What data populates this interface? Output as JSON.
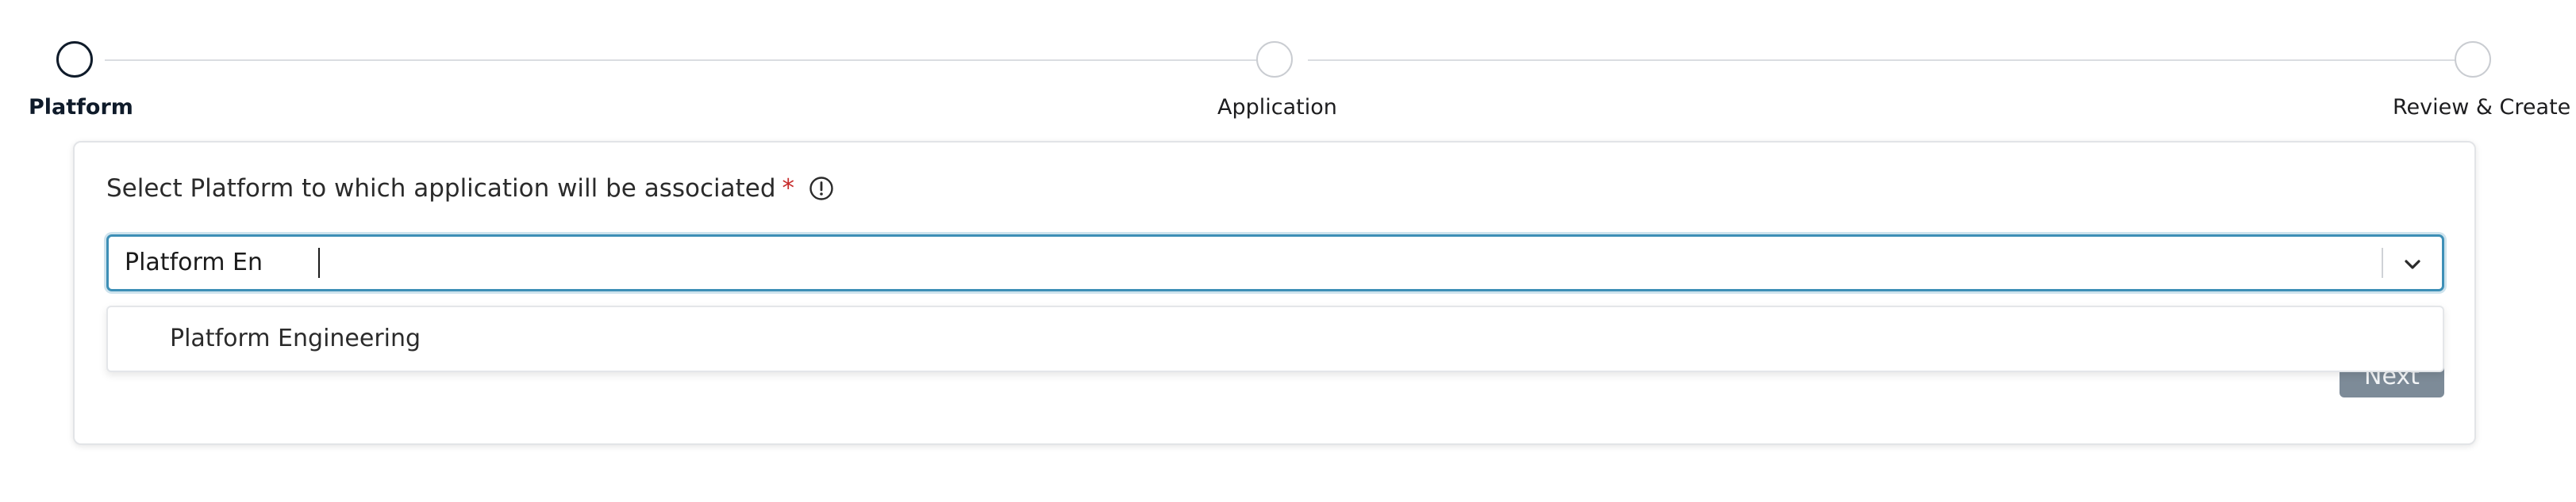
{
  "stepper": {
    "steps": [
      {
        "label": "Platform",
        "state": "active"
      },
      {
        "label": "Application",
        "state": "pending"
      },
      {
        "label": "Review & Create",
        "state": "pending"
      }
    ]
  },
  "form": {
    "label": "Select Platform to which application will be associated",
    "required_marker": "*",
    "info_icon": "info-circle-icon",
    "select": {
      "value": "Platform En",
      "toggle_icon": "chevron-down-icon"
    },
    "dropdown": {
      "options": [
        {
          "label": "Platform Engineering"
        }
      ]
    },
    "next_label": "Next"
  },
  "colors": {
    "accent_focus": "#3d8fb6",
    "active_step": "#0f1b2a",
    "required": "#c72b2b",
    "button_disabled": "#7d8b98"
  }
}
